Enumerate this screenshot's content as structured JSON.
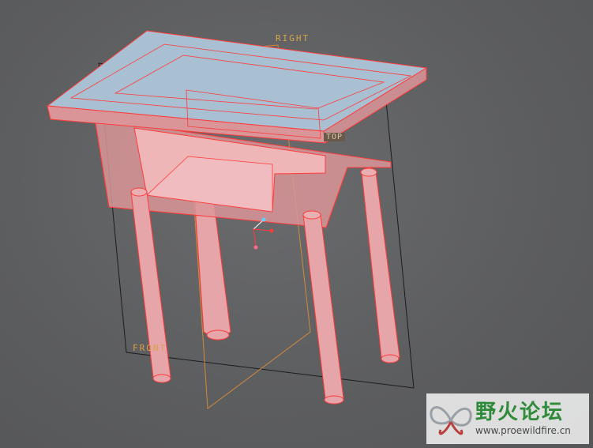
{
  "viewport": {
    "background": "#5f6062",
    "model_edge_color": "#ff3333",
    "model_fill_color": "#e8a0a0",
    "top_surface_color": "#aac3d6",
    "datum_color": "#d9a24a"
  },
  "datums": {
    "right_plane_label": "RIGHT",
    "front_plane_label": "FRONT",
    "top_plane_label": "TOP"
  },
  "model": {
    "name": "table",
    "parts": [
      "tabletop",
      "apron",
      "drawer-opening",
      "leg",
      "leg",
      "leg",
      "leg"
    ]
  },
  "coordinate_system": {
    "axes": [
      "x-axis",
      "y-axis",
      "z-axis"
    ],
    "icon": "csys-icon"
  },
  "watermark": {
    "title": "野火论坛",
    "url": "www.proewildfire.cn",
    "icon": "butterfly-logo-icon"
  }
}
